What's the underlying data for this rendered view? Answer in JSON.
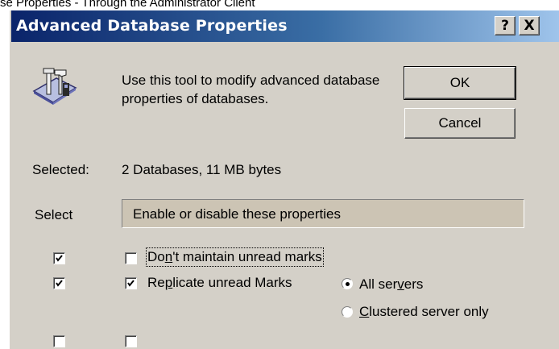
{
  "page_caption": "se Properties - Through the Administrator Client",
  "dialog": {
    "title": "Advanced Database Properties",
    "help_label": "?",
    "close_label": "X",
    "description": "Use this tool to modify advanced database properties of databases.",
    "ok_label": "OK",
    "cancel_label": "Cancel",
    "selected_label": "Selected:",
    "selected_value": "2 Databases, 11 MB bytes",
    "select_column_label": "Select",
    "group_header": "Enable or disable these properties",
    "properties": [
      {
        "label_pre": "Do",
        "label_accel": "n",
        "label_post": "'t maintain unread marks",
        "select_checked": true,
        "property_checked": false
      },
      {
        "label_pre": "Re",
        "label_accel": "p",
        "label_post": "licate unread Marks",
        "select_checked": true,
        "property_checked": true
      }
    ],
    "replicate_options": [
      {
        "label_pre": "All ser",
        "label_accel": "v",
        "label_post": "ers",
        "selected": true
      },
      {
        "label_pre": "",
        "label_accel": "C",
        "label_post": "lustered server only",
        "selected": false
      }
    ],
    "tool_icon": "database-tools-icon"
  }
}
